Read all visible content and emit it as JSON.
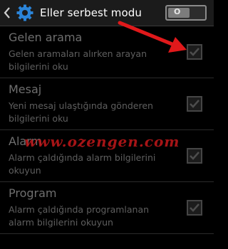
{
  "header": {
    "title": "Eller serbest modu",
    "toggle_state": "on",
    "back_icon": "back-arrow-icon",
    "settings_icon": "gear-icon"
  },
  "items": [
    {
      "title": "Gelen arama",
      "description": "Gelen aramaları alırken arayan bilgilerini oku",
      "checked": true
    },
    {
      "title": "Mesaj",
      "description": "Yeni mesaj ulaştığında gönderen bilgilerini oku",
      "checked": true
    },
    {
      "title": "Alarm",
      "description": "Alarm çaldığında alarm bilgilerini okuyun",
      "checked": true
    },
    {
      "title": "Program",
      "description": "Alarm çaldığında programlanan alarm bilgilerini okuyun",
      "checked": true
    }
  ],
  "watermark": "www.ozengen.com",
  "colors": {
    "annotation_arrow": "#e0191b",
    "watermark": "#c2181b"
  }
}
